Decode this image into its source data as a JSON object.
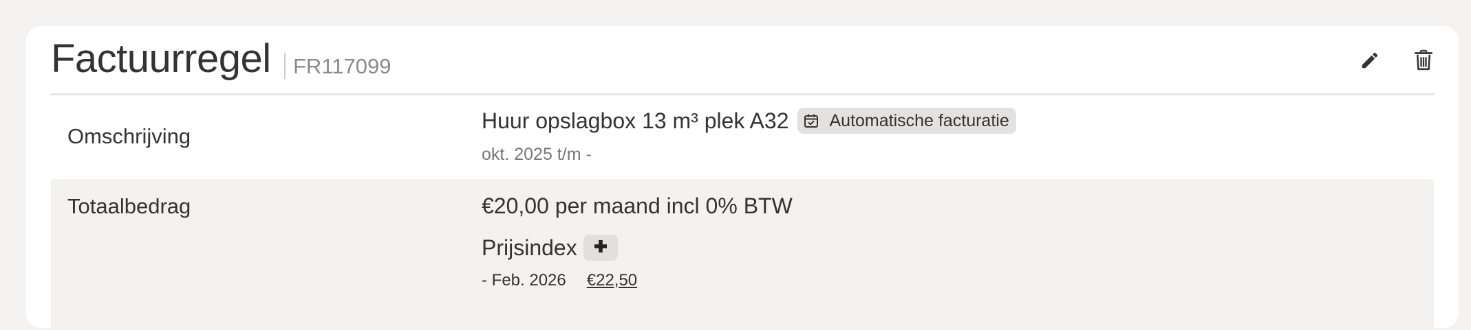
{
  "card": {
    "title": "Factuurregel",
    "code": "FR117099",
    "actions": {
      "edit_icon": "pencil-icon",
      "delete_icon": "trash-icon"
    }
  },
  "rows": {
    "description": {
      "label": "Omschrijving",
      "text": "Huur opslagbox 13 m³ plek A32",
      "badge_icon": "calendar-check-icon",
      "badge": "Automatische facturatie",
      "period": "okt. 2025 t/m -"
    },
    "total": {
      "label": "Totaalbedrag",
      "amount_text": "€20,00 per maand incl 0% BTW",
      "index_label": "Prijsindex",
      "index_add_icon": "plus-icon",
      "index_date": "- Feb. 2026",
      "index_amount": "€22,50"
    }
  },
  "colors": {
    "background": "#f4f3f2",
    "card": "#ffffff",
    "striped_row": "#f3f2f1",
    "badge": "#e3e2e1",
    "text": "#333333",
    "muted": "#8a8a8a"
  }
}
